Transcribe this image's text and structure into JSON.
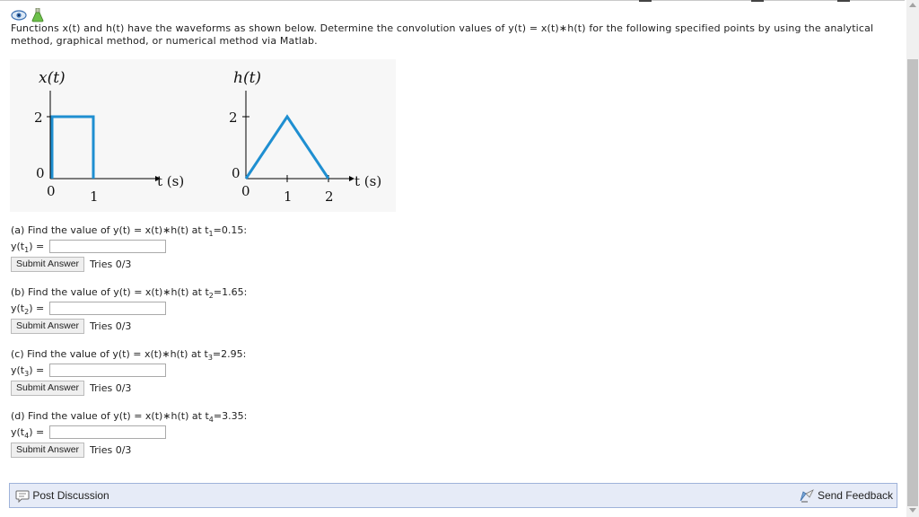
{
  "problem": {
    "text": "Functions x(t) and h(t) have the waveforms as shown below. Determine the convolution values of y(t) = x(t)∗h(t) for the following specified points by using the analytical method, graphical method, or numerical method via Matlab."
  },
  "figure": {
    "left_plot": {
      "title": "x(t)",
      "y_tick_top": "2",
      "y_tick_zero": "0",
      "x_tick_zero": "0",
      "x_tick_one": "1",
      "axis_label": "t (s)"
    },
    "right_plot": {
      "title": "h(t)",
      "y_tick_top": "2",
      "y_tick_zero": "0",
      "x_tick_zero": "0",
      "x_tick_one": "1",
      "x_tick_two": "2",
      "axis_label": "t (s)"
    },
    "line_color": "#1f8fd1"
  },
  "parts": [
    {
      "question": "(a) Find the value of y(t) = x(t)∗h(t) at t",
      "sub": "1",
      "point": "=0.15:",
      "label_pre": "y(t",
      "label_post": ") =",
      "input_value": "",
      "button": "Submit Answer",
      "tries": "Tries 0/3"
    },
    {
      "question": "(b) Find the value of y(t) = x(t)∗h(t) at t",
      "sub": "2",
      "point": "=1.65:",
      "label_pre": "y(t",
      "label_post": ") =",
      "input_value": "",
      "button": "Submit Answer",
      "tries": "Tries 0/3"
    },
    {
      "question": "(c) Find the value of y(t) = x(t)∗h(t) at t",
      "sub": "3",
      "point": "=2.95:",
      "label_pre": "y(t",
      "label_post": ") =",
      "input_value": "",
      "button": "Submit Answer",
      "tries": "Tries 0/3"
    },
    {
      "question": "(d) Find the value of y(t) = x(t)∗h(t) at t",
      "sub": "4",
      "point": "=3.35:",
      "label_pre": "y(t",
      "label_post": ") =",
      "input_value": "",
      "button": "Submit Answer",
      "tries": "Tries 0/3"
    }
  ],
  "footer": {
    "post_discussion": "Post Discussion",
    "send_feedback": "Send Feedback"
  },
  "icons": {
    "eye": "eye-icon",
    "flask": "flask-icon",
    "discussion": "discussion-icon",
    "feedback": "feedback-icon"
  }
}
